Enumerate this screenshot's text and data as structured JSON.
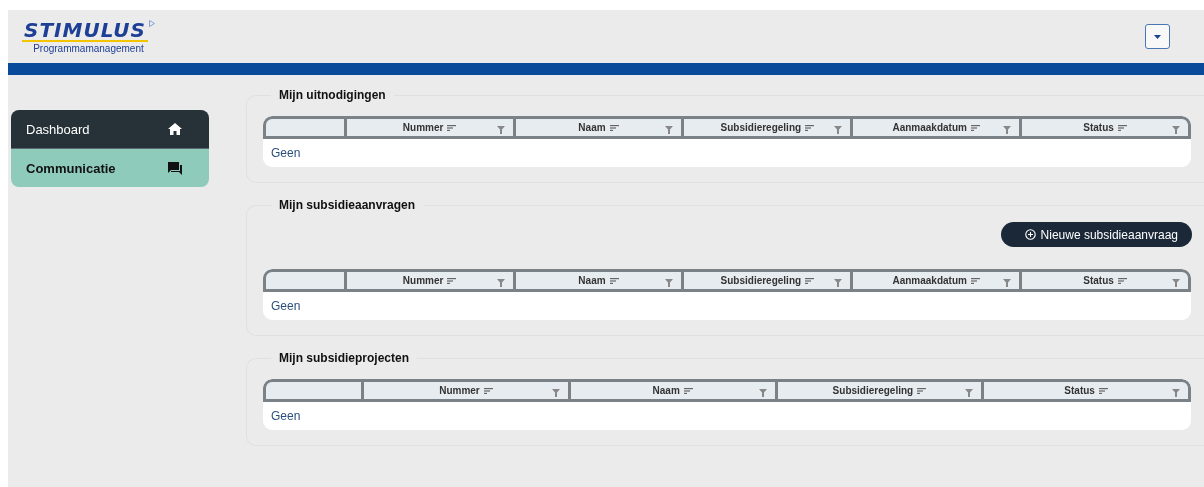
{
  "header": {
    "logo": {
      "name": "STIMULUS",
      "tagline": "Programmamanagement"
    }
  },
  "sidebar": {
    "items": [
      {
        "label": "Dashboard",
        "kind": "home",
        "selected": true
      },
      {
        "label": "Communicatie",
        "kind": "chat",
        "selected": false
      }
    ]
  },
  "sections": [
    {
      "title": "Mijn uitnodigingen",
      "columns": [
        "Nummer",
        "Naam",
        "Subsidieregeling",
        "Aanmaakdatum",
        "Status"
      ],
      "empty_text": "Geen"
    },
    {
      "title": "Mijn subsidieaanvragen",
      "action": {
        "label": "Nieuwe subsidieaanvraag"
      },
      "columns": [
        "Nummer",
        "Naam",
        "Subsidieregeling",
        "Aanmaakdatum",
        "Status"
      ],
      "empty_text": "Geen"
    },
    {
      "title": "Mijn subsidieprojecten",
      "columns": [
        "Nummer",
        "Naam",
        "Subsidieregeling",
        "Status"
      ],
      "empty_text": "Geen"
    }
  ]
}
